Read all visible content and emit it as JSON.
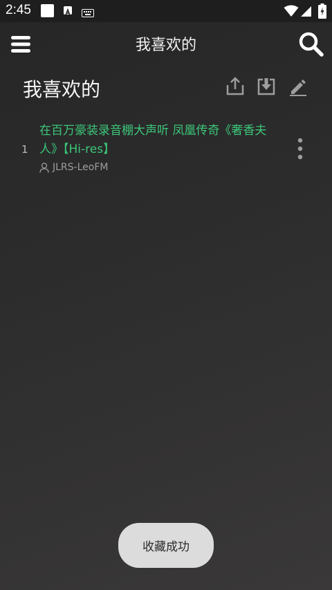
{
  "status_bar": {
    "time": "2:45",
    "icons": [
      "notification-square-icon",
      "a-badge-icon",
      "keyboard-icon",
      "wifi-icon",
      "signal-icon",
      "battery-charging-icon"
    ]
  },
  "app_bar": {
    "title": "我喜欢的",
    "menu_icon": "hamburger-menu-icon",
    "search_icon": "search-icon"
  },
  "playlist": {
    "title": "我喜欢的",
    "actions": [
      "share-icon",
      "download-icon",
      "edit-icon"
    ],
    "songs": [
      {
        "index": "1",
        "title": "在百万豪装录音棚大声听 凤凰传奇《奢香夫人》【Hi-res】",
        "artist": "JLRS-LeoFM"
      }
    ]
  },
  "toast": {
    "message": "收藏成功"
  },
  "colors": {
    "accent": "#3cc77a",
    "background": "#2c2c2c",
    "status_bar": "#1e1e1e",
    "toast_bg": "#dcdcdc"
  }
}
